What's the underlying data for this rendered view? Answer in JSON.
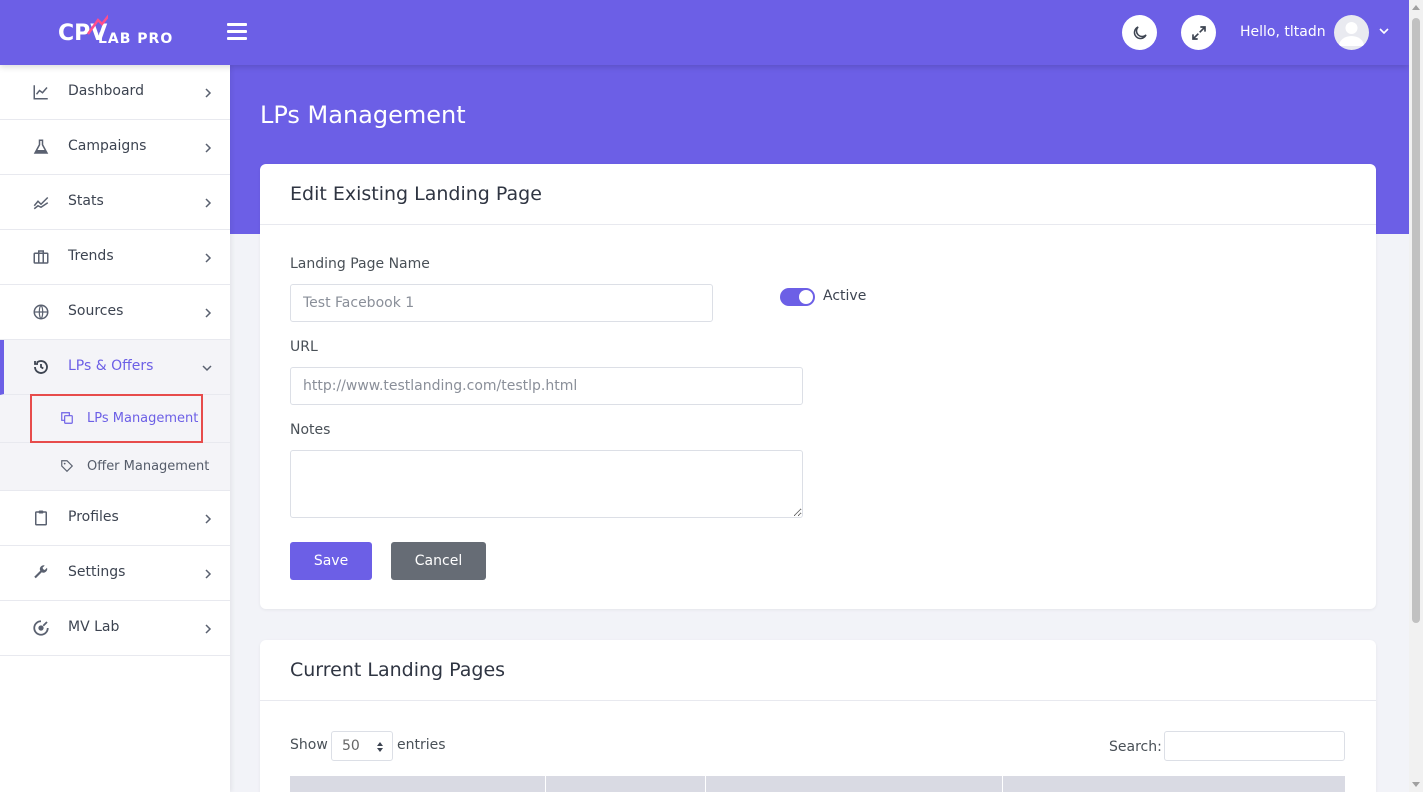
{
  "header": {
    "logo_text": "LAB PRO",
    "logo_mark": "CPV",
    "greeting": "Hello, tltadn",
    "icons": [
      "hamburger-menu-icon",
      "moon-icon",
      "expand-icon",
      "user-avatar-icon",
      "chevron-down-icon"
    ]
  },
  "sidebar": {
    "items": [
      {
        "label": "Dashboard",
        "icon": "chart-line-icon"
      },
      {
        "label": "Campaigns",
        "icon": "flask-icon"
      },
      {
        "label": "Stats",
        "icon": "trend-icon"
      },
      {
        "label": "Trends",
        "icon": "briefcase-icon"
      },
      {
        "label": "Sources",
        "icon": "globe-icon"
      },
      {
        "label": "LPs & Offers",
        "icon": "history-icon"
      },
      {
        "label": "Profiles",
        "icon": "clipboard-icon"
      },
      {
        "label": "Settings",
        "icon": "wrench-icon"
      },
      {
        "label": "MV Lab",
        "icon": "target-icon"
      }
    ],
    "sub_items": [
      {
        "label": "LPs Management",
        "icon": "copy-icon"
      },
      {
        "label": "Offer Management",
        "icon": "tag-icon"
      }
    ]
  },
  "page": {
    "title": "LPs Management"
  },
  "edit_form": {
    "title": "Edit Existing Landing Page",
    "name_label": "Landing Page Name",
    "name_placeholder": "Test Facebook 1",
    "active_label": "Active",
    "url_label": "URL",
    "url_placeholder": "http://www.testlanding.com/testlp.html",
    "notes_label": "Notes",
    "save_label": "Save",
    "cancel_label": "Cancel"
  },
  "table_section": {
    "title": "Current Landing Pages",
    "show_label": "Show",
    "entries_value": "50",
    "entries_label": "entries",
    "search_label": "Search:"
  },
  "colors": {
    "primary": "#6c5fe6",
    "secondary_button": "#666c75",
    "highlight_box": "#e74c4c"
  }
}
